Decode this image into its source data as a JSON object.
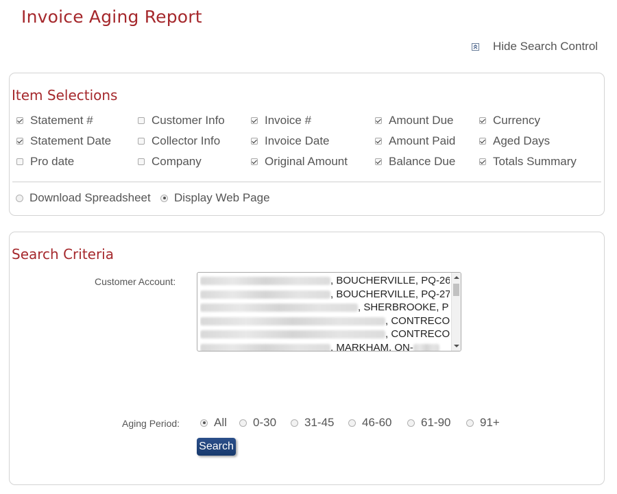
{
  "page": {
    "title": "Invoice Aging Report",
    "hide_search_label": "Hide Search Control"
  },
  "item_selections": {
    "heading": "Item Selections",
    "options": [
      {
        "label": "Statement #",
        "checked": true
      },
      {
        "label": "Statement Date",
        "checked": true
      },
      {
        "label": "Pro date",
        "checked": false
      },
      {
        "label": "Customer Info",
        "checked": false
      },
      {
        "label": "Collector Info",
        "checked": false
      },
      {
        "label": "Company",
        "checked": false
      },
      {
        "label": "Invoice #",
        "checked": true
      },
      {
        "label": "Invoice Date",
        "checked": true
      },
      {
        "label": "Original Amount",
        "checked": true
      },
      {
        "label": "Amount Due",
        "checked": true
      },
      {
        "label": "Amount Paid",
        "checked": true
      },
      {
        "label": "Balance Due",
        "checked": true
      },
      {
        "label": "Currency",
        "checked": true
      },
      {
        "label": "Aged Days",
        "checked": true
      },
      {
        "label": "Totals Summary",
        "checked": true
      }
    ],
    "output": {
      "download_label": "Download Spreadsheet",
      "display_label": "Display Web Page",
      "selected": "Display Web Page"
    }
  },
  "search_criteria": {
    "heading": "Search Criteria",
    "customer_account_label": "Customer Account:",
    "customer_accounts": [
      ", BOUCHERVILLE, PQ-26",
      ", BOUCHERVILLE, PQ-27",
      ", SHERBROOKE, P",
      ", CONTRECO",
      ", CONTRECO",
      ", MARKHAM, ON-"
    ],
    "aging_period_label": "Aging Period:",
    "aging_periods": [
      "All",
      "0-30",
      "31-45",
      "46-60",
      "61-90",
      "91+"
    ],
    "aging_selected": "All",
    "search_button": "Search"
  },
  "colors": {
    "accent": "#a5282c",
    "button": "#1f4379"
  },
  "icons": {
    "hide_search": "collapse-up-icon"
  }
}
